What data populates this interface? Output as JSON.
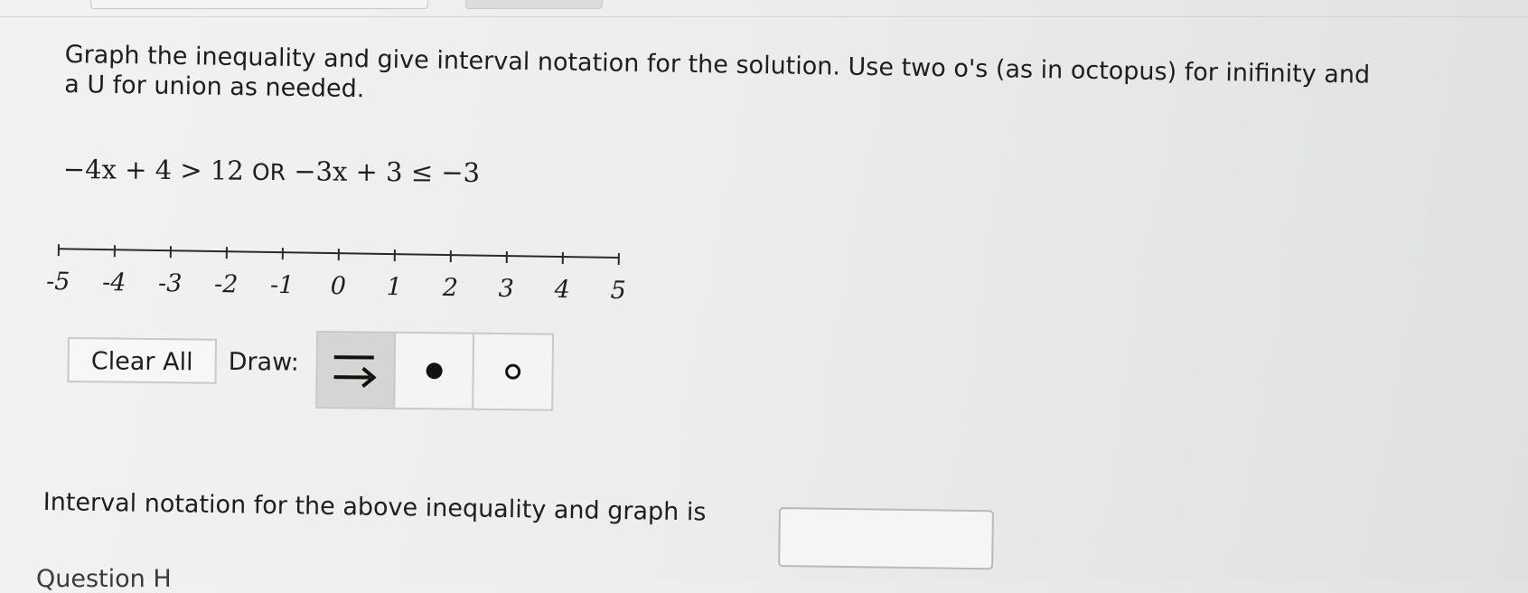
{
  "question": {
    "prompt_line1": "Graph the inequality and give interval notation for the solution. Use two o's (as in octopus) for inifinity and",
    "prompt_line2": "a U for union as needed.",
    "inequality": {
      "left_part": "−4x + 4 > 12",
      "or_word": "OR",
      "right_part": "−3x + 3 ≤ −3"
    }
  },
  "number_line": {
    "ticks": [
      "-5",
      "-4",
      "-3",
      "-2",
      "-1",
      "0",
      "1",
      "2",
      "3",
      "4",
      "5"
    ]
  },
  "graph_tools": {
    "clear_all_label": "Clear All",
    "draw_label": "Draw:",
    "tools": [
      {
        "name": "ray",
        "icon": "ray-arrow-icon",
        "selected": true
      },
      {
        "name": "closed-dot",
        "icon": "filled-circle-icon",
        "selected": false
      },
      {
        "name": "open-dot",
        "icon": "open-circle-icon",
        "selected": false
      }
    ]
  },
  "answer": {
    "label": "Interval notation for the above inequality and graph is",
    "value": ""
  },
  "cut_text": "Question H"
}
